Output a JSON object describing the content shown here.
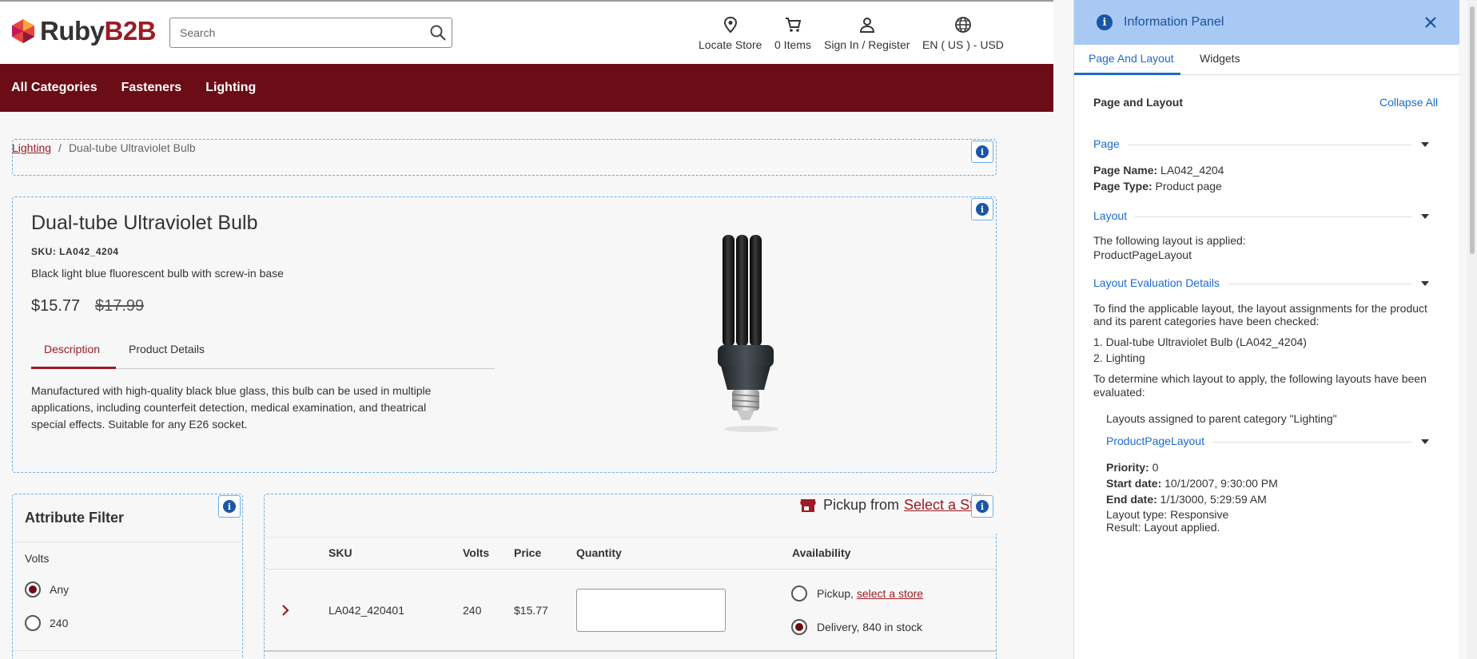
{
  "header": {
    "logo_main": "Ruby",
    "logo_accent": "B2B",
    "search_placeholder": "Search",
    "nav": {
      "locate_store": "Locate Store",
      "cart": "0 Items",
      "sign_in": "Sign In / Register",
      "locale": "EN ( US ) - USD"
    }
  },
  "topnav": [
    "All Categories",
    "Fasteners",
    "Lighting"
  ],
  "breadcrumb": {
    "parent": "Lighting",
    "separator": "/",
    "current": "Dual-tube Ultraviolet Bulb"
  },
  "product": {
    "title": "Dual-tube Ultraviolet Bulb",
    "sku": "SKU: LA042_4204",
    "short_description": "Black light blue fluorescent bulb with screw-in base",
    "price": "$15.77",
    "old_price": "$17.99",
    "tabs": [
      "Description",
      "Product Details"
    ],
    "description": "Manufactured with high-quality black blue glass, this bulb can be used in multiple applications, including counterfeit detection, medical examination, and theatrical special effects. Suitable for any E26 socket."
  },
  "attribute_filter": {
    "title": "Attribute Filter",
    "group": "Volts",
    "options": [
      {
        "label": "Any",
        "selected": true
      },
      {
        "label": "240",
        "selected": false
      }
    ]
  },
  "variants": {
    "pickup_label": "Pickup from",
    "pickup_link": "Select a Store",
    "columns": [
      "SKU",
      "Volts",
      "Price",
      "Quantity",
      "Availability"
    ],
    "rows": [
      {
        "sku": "LA042_420401",
        "volts": "240",
        "price": "$15.77",
        "quantity": "",
        "pickup_label": "Pickup,",
        "pickup_link": "select a store",
        "delivery": "Delivery, 840 in stock"
      }
    ]
  },
  "panel": {
    "title": "Information Panel",
    "tabs": [
      "Page And Layout",
      "Widgets"
    ],
    "heading": "Page and Layout",
    "collapse_all": "Collapse All",
    "page_section": "Page",
    "page_name_label": "Page Name:",
    "page_name": "LA042_4204",
    "page_type_label": "Page Type:",
    "page_type": "Product page",
    "layout_section": "Layout",
    "layout_line1": "The following layout is applied:",
    "layout_line2": "ProductPageLayout",
    "eval_section": "Layout Evaluation Details",
    "eval_intro_1": "To find the applicable layout, the layout assignments for the product",
    "eval_intro_2": "and its parent categories have been checked:",
    "eval_item_1": "1. Dual-tube Ultraviolet Bulb (LA042_4204)",
    "eval_item_2": "2. Lighting",
    "eval_determine_1": "To determine which layout to apply, the following layouts have been",
    "eval_determine_2": "evaluated:",
    "assigned": "Layouts assigned to parent category \"Lighting\"",
    "layout_name": "ProductPageLayout",
    "priority_label": "Priority:",
    "priority": "0",
    "start_label": "Start date:",
    "start": "10/1/2007, 9:30:00 PM",
    "end_label": "End date:",
    "end": "1/1/3000, 5:29:59 AM",
    "layout_type": "Layout type: Responsive",
    "result": "Result: Layout applied."
  },
  "colors": {
    "brand": "#9b1c24",
    "nav_bg": "#6b0d16",
    "panel_header": "#a9c9f5",
    "panel_accent": "#1a6bd0",
    "dashed_border": "#6aaee6"
  }
}
